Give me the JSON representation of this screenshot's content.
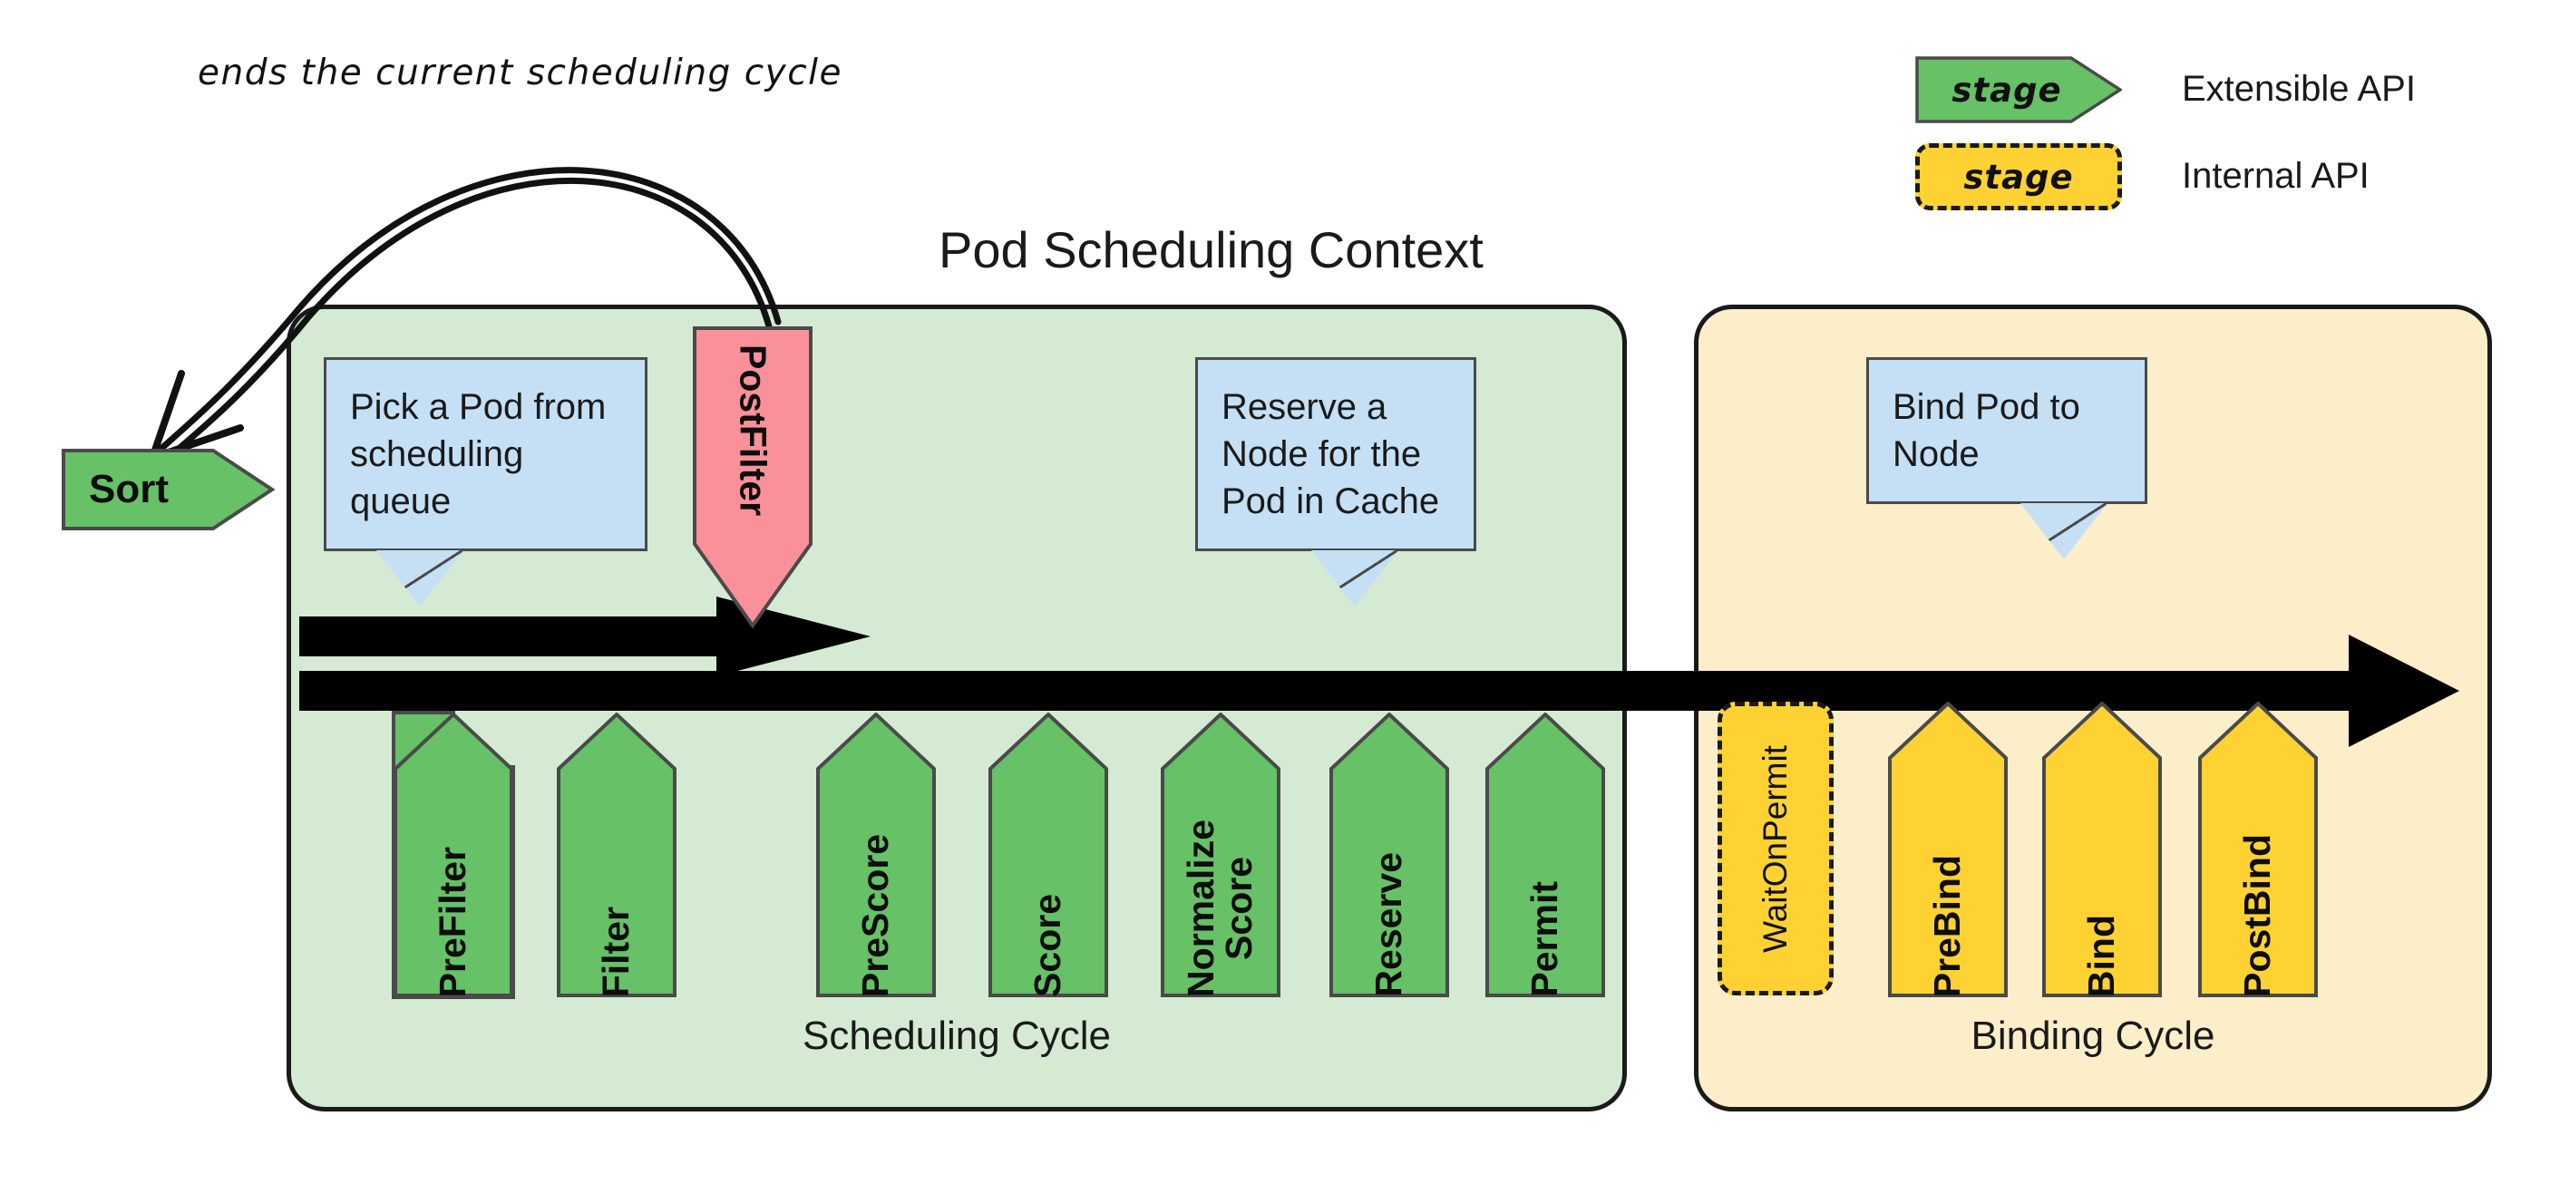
{
  "annotation": {
    "text": "ends the current scheduling cycle"
  },
  "title": "Pod Scheduling Context",
  "legend": {
    "rows": [
      {
        "chip_label": "stage",
        "description": "Extensible API",
        "color": "#66c167",
        "style": "solid"
      },
      {
        "chip_label": "stage",
        "description": "Internal API",
        "color": "#ffd233",
        "style": "dashed"
      }
    ]
  },
  "sort_stage": {
    "label": "Sort",
    "color": "#66c167"
  },
  "scheduling_cycle": {
    "panel_label": "Scheduling Cycle",
    "panel_color": "#d5ead2",
    "callouts": [
      {
        "text": "Pick a Pod from scheduling queue",
        "color": "#c5e0f5"
      },
      {
        "text": "Reserve a Node for the Pod in Cache",
        "color": "#c5e0f5"
      }
    ],
    "postfilter": {
      "label": "PostFilter",
      "color": "#fa9099"
    },
    "stages": [
      {
        "label": "PreFilter",
        "color": "#66c167",
        "style": "solid"
      },
      {
        "label": "Filter",
        "color": "#66c167",
        "style": "solid"
      },
      {
        "label": "PreScore",
        "color": "#66c167",
        "style": "solid"
      },
      {
        "label": "Score",
        "color": "#66c167",
        "style": "solid"
      },
      {
        "label": "Normalize\nScore",
        "color": "#66c167",
        "style": "solid"
      },
      {
        "label": "Reserve",
        "color": "#66c167",
        "style": "solid"
      },
      {
        "label": "Permit",
        "color": "#66c167",
        "style": "solid"
      }
    ]
  },
  "binding_cycle": {
    "panel_label": "Binding Cycle",
    "panel_color": "#fceec9",
    "callouts": [
      {
        "text": "Bind Pod to Node",
        "color": "#c5e0f5"
      }
    ],
    "stages": [
      {
        "label": "WaitOnPermit",
        "color": "#ffd233",
        "style": "dashed"
      },
      {
        "label": "PreBind",
        "color": "#ffd233",
        "style": "solid"
      },
      {
        "label": "Bind",
        "color": "#ffd233",
        "style": "solid"
      },
      {
        "label": "PostBind",
        "color": "#ffd233",
        "style": "solid"
      }
    ]
  }
}
